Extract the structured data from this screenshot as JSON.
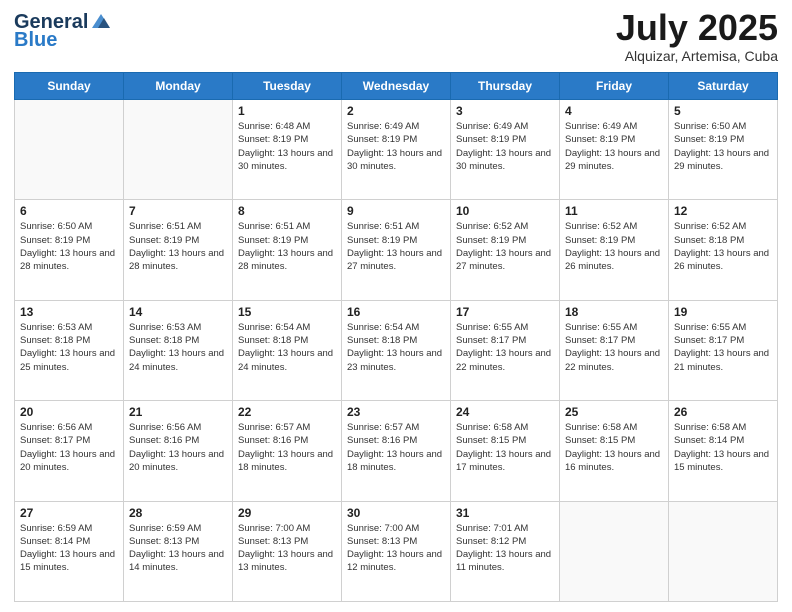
{
  "header": {
    "logo_general": "General",
    "logo_blue": "Blue",
    "title": "July 2025",
    "location": "Alquizar, Artemisa, Cuba"
  },
  "days_of_week": [
    "Sunday",
    "Monday",
    "Tuesday",
    "Wednesday",
    "Thursday",
    "Friday",
    "Saturday"
  ],
  "weeks": [
    [
      {
        "day": "",
        "info": ""
      },
      {
        "day": "",
        "info": ""
      },
      {
        "day": "1",
        "info": "Sunrise: 6:48 AM\nSunset: 8:19 PM\nDaylight: 13 hours and 30 minutes."
      },
      {
        "day": "2",
        "info": "Sunrise: 6:49 AM\nSunset: 8:19 PM\nDaylight: 13 hours and 30 minutes."
      },
      {
        "day": "3",
        "info": "Sunrise: 6:49 AM\nSunset: 8:19 PM\nDaylight: 13 hours and 30 minutes."
      },
      {
        "day": "4",
        "info": "Sunrise: 6:49 AM\nSunset: 8:19 PM\nDaylight: 13 hours and 29 minutes."
      },
      {
        "day": "5",
        "info": "Sunrise: 6:50 AM\nSunset: 8:19 PM\nDaylight: 13 hours and 29 minutes."
      }
    ],
    [
      {
        "day": "6",
        "info": "Sunrise: 6:50 AM\nSunset: 8:19 PM\nDaylight: 13 hours and 28 minutes."
      },
      {
        "day": "7",
        "info": "Sunrise: 6:51 AM\nSunset: 8:19 PM\nDaylight: 13 hours and 28 minutes."
      },
      {
        "day": "8",
        "info": "Sunrise: 6:51 AM\nSunset: 8:19 PM\nDaylight: 13 hours and 28 minutes."
      },
      {
        "day": "9",
        "info": "Sunrise: 6:51 AM\nSunset: 8:19 PM\nDaylight: 13 hours and 27 minutes."
      },
      {
        "day": "10",
        "info": "Sunrise: 6:52 AM\nSunset: 8:19 PM\nDaylight: 13 hours and 27 minutes."
      },
      {
        "day": "11",
        "info": "Sunrise: 6:52 AM\nSunset: 8:19 PM\nDaylight: 13 hours and 26 minutes."
      },
      {
        "day": "12",
        "info": "Sunrise: 6:52 AM\nSunset: 8:18 PM\nDaylight: 13 hours and 26 minutes."
      }
    ],
    [
      {
        "day": "13",
        "info": "Sunrise: 6:53 AM\nSunset: 8:18 PM\nDaylight: 13 hours and 25 minutes."
      },
      {
        "day": "14",
        "info": "Sunrise: 6:53 AM\nSunset: 8:18 PM\nDaylight: 13 hours and 24 minutes."
      },
      {
        "day": "15",
        "info": "Sunrise: 6:54 AM\nSunset: 8:18 PM\nDaylight: 13 hours and 24 minutes."
      },
      {
        "day": "16",
        "info": "Sunrise: 6:54 AM\nSunset: 8:18 PM\nDaylight: 13 hours and 23 minutes."
      },
      {
        "day": "17",
        "info": "Sunrise: 6:55 AM\nSunset: 8:17 PM\nDaylight: 13 hours and 22 minutes."
      },
      {
        "day": "18",
        "info": "Sunrise: 6:55 AM\nSunset: 8:17 PM\nDaylight: 13 hours and 22 minutes."
      },
      {
        "day": "19",
        "info": "Sunrise: 6:55 AM\nSunset: 8:17 PM\nDaylight: 13 hours and 21 minutes."
      }
    ],
    [
      {
        "day": "20",
        "info": "Sunrise: 6:56 AM\nSunset: 8:17 PM\nDaylight: 13 hours and 20 minutes."
      },
      {
        "day": "21",
        "info": "Sunrise: 6:56 AM\nSunset: 8:16 PM\nDaylight: 13 hours and 20 minutes."
      },
      {
        "day": "22",
        "info": "Sunrise: 6:57 AM\nSunset: 8:16 PM\nDaylight: 13 hours and 18 minutes."
      },
      {
        "day": "23",
        "info": "Sunrise: 6:57 AM\nSunset: 8:16 PM\nDaylight: 13 hours and 18 minutes."
      },
      {
        "day": "24",
        "info": "Sunrise: 6:58 AM\nSunset: 8:15 PM\nDaylight: 13 hours and 17 minutes."
      },
      {
        "day": "25",
        "info": "Sunrise: 6:58 AM\nSunset: 8:15 PM\nDaylight: 13 hours and 16 minutes."
      },
      {
        "day": "26",
        "info": "Sunrise: 6:58 AM\nSunset: 8:14 PM\nDaylight: 13 hours and 15 minutes."
      }
    ],
    [
      {
        "day": "27",
        "info": "Sunrise: 6:59 AM\nSunset: 8:14 PM\nDaylight: 13 hours and 15 minutes."
      },
      {
        "day": "28",
        "info": "Sunrise: 6:59 AM\nSunset: 8:13 PM\nDaylight: 13 hours and 14 minutes."
      },
      {
        "day": "29",
        "info": "Sunrise: 7:00 AM\nSunset: 8:13 PM\nDaylight: 13 hours and 13 minutes."
      },
      {
        "day": "30",
        "info": "Sunrise: 7:00 AM\nSunset: 8:13 PM\nDaylight: 13 hours and 12 minutes."
      },
      {
        "day": "31",
        "info": "Sunrise: 7:01 AM\nSunset: 8:12 PM\nDaylight: 13 hours and 11 minutes."
      },
      {
        "day": "",
        "info": ""
      },
      {
        "day": "",
        "info": ""
      }
    ]
  ]
}
